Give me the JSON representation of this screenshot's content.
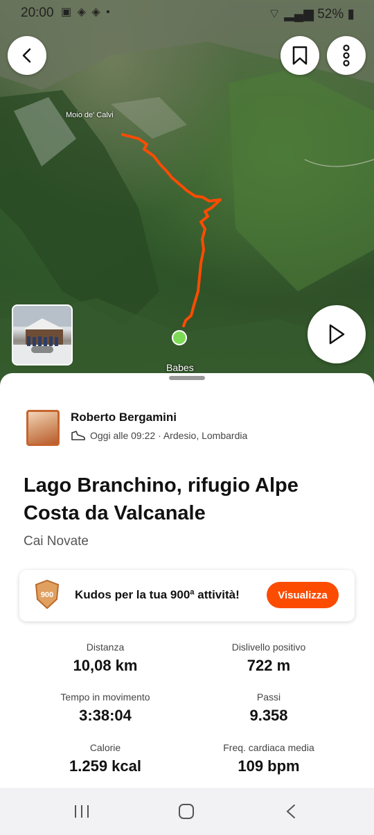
{
  "status_bar": {
    "time": "20:00",
    "battery": "52%"
  },
  "map": {
    "place_label_top": "Moio de' Calvi",
    "place_label_bottom": "Babes",
    "route_color": "#fc4c02"
  },
  "activity": {
    "athlete_name": "Roberto Bergamini",
    "meta": "Oggi alle 09:22 · Ardesio, Lombardia",
    "title": "Lago Branchino, rifugio Alpe Costa da Valcanale",
    "group": "Cai Novate"
  },
  "kudos": {
    "badge_number": "900",
    "text": "Kudos per la tua 900ª attività!",
    "button_label": "Visualizza"
  },
  "stats": [
    {
      "label": "Distanza",
      "value": "10,08 km"
    },
    {
      "label": "Dislivello positivo",
      "value": "722 m"
    },
    {
      "label": "Tempo in movimento",
      "value": "3:38:04"
    },
    {
      "label": "Passi",
      "value": "9.358"
    },
    {
      "label": "Calorie",
      "value": "1.259 kcal"
    },
    {
      "label": "Freq. cardiaca media",
      "value": "109 bpm"
    }
  ],
  "colors": {
    "accent": "#fc4c02",
    "start_marker": "#7ed957"
  }
}
